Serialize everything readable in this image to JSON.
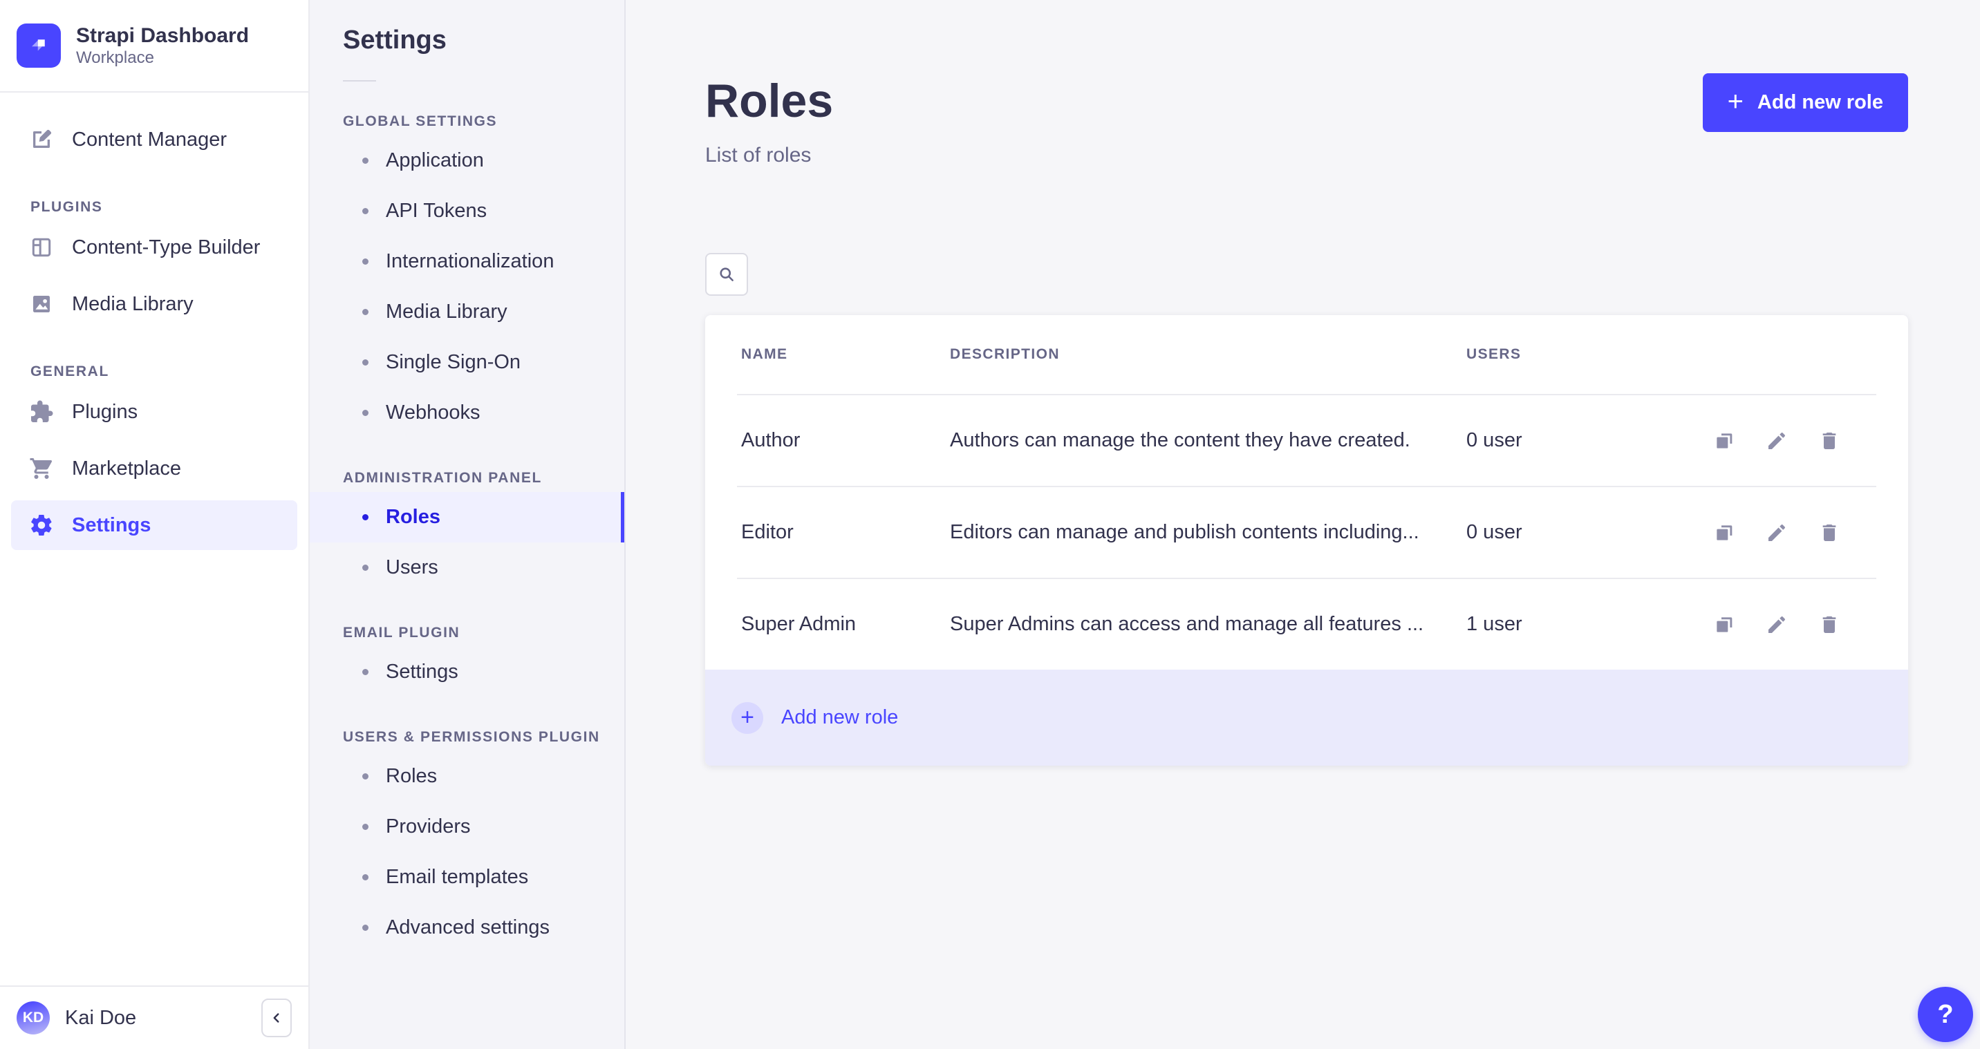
{
  "colors": {
    "primary": "#4945ff",
    "primary_dark_text": "#271fe0",
    "active_bg": "#f0f0ff",
    "table_footer_bg": "#eaeafc",
    "text_dark": "#32324d",
    "text_muted": "#666687",
    "icon_gray": "#8e8ea9",
    "border": "#eaeaef"
  },
  "sidebar": {
    "logo_title": "Strapi Dashboard",
    "logo_subtitle": "Workplace",
    "sections": [
      {
        "header": "",
        "items": [
          {
            "label": "Content Manager",
            "icon": "pen-icon",
            "active": false
          }
        ]
      },
      {
        "header": "PLUGINS",
        "items": [
          {
            "label": "Content-Type Builder",
            "icon": "layout-icon",
            "active": false
          },
          {
            "label": "Media Library",
            "icon": "image-icon",
            "active": false
          }
        ]
      },
      {
        "header": "GENERAL",
        "items": [
          {
            "label": "Plugins",
            "icon": "puzzle-icon",
            "active": false
          },
          {
            "label": "Marketplace",
            "icon": "cart-icon",
            "active": false
          },
          {
            "label": "Settings",
            "icon": "gear-icon",
            "active": true
          }
        ]
      }
    ],
    "user": {
      "initials": "KD",
      "name": "Kai Doe"
    },
    "collapse_icon": "chevron-left-icon"
  },
  "subnav": {
    "title": "Settings",
    "sections": [
      {
        "header": "GLOBAL SETTINGS",
        "items": [
          {
            "label": "Application",
            "active": false
          },
          {
            "label": "API Tokens",
            "active": false
          },
          {
            "label": "Internationalization",
            "active": false
          },
          {
            "label": "Media Library",
            "active": false
          },
          {
            "label": "Single Sign-On",
            "active": false
          },
          {
            "label": "Webhooks",
            "active": false
          }
        ]
      },
      {
        "header": "ADMINISTRATION PANEL",
        "items": [
          {
            "label": "Roles",
            "active": true
          },
          {
            "label": "Users",
            "active": false
          }
        ]
      },
      {
        "header": "EMAIL PLUGIN",
        "items": [
          {
            "label": "Settings",
            "active": false
          }
        ]
      },
      {
        "header": "USERS & PERMISSIONS PLUGIN",
        "items": [
          {
            "label": "Roles",
            "active": false
          },
          {
            "label": "Providers",
            "active": false
          },
          {
            "label": "Email templates",
            "active": false
          },
          {
            "label": "Advanced settings",
            "active": false
          }
        ]
      }
    ]
  },
  "main": {
    "title": "Roles",
    "subtitle": "List of roles",
    "add_button_label": "Add new role",
    "plus": "+",
    "search_icon": "search-icon",
    "table": {
      "columns": [
        "NAME",
        "DESCRIPTION",
        "USERS"
      ],
      "rows": [
        {
          "name": "Author",
          "description": "Authors can manage the content they have created.",
          "users": "0 user"
        },
        {
          "name": "Editor",
          "description": "Editors can manage and publish contents including...",
          "users": "0 user"
        },
        {
          "name": "Super Admin",
          "description": "Super Admins can access and manage all features ...",
          "users": "1 user"
        }
      ],
      "row_actions": [
        "duplicate",
        "edit",
        "delete"
      ],
      "footer_add_label": "Add new role"
    },
    "help_label": "?"
  }
}
